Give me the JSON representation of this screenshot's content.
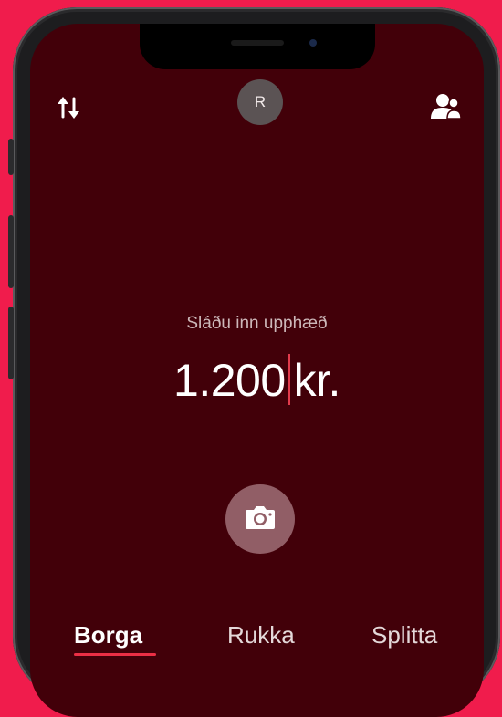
{
  "header": {
    "avatar_initial": "R",
    "icons": [
      "swap-arrows-icon",
      "avatar",
      "contacts-icon"
    ]
  },
  "main": {
    "prompt": "Sláðu inn upphæð",
    "amount_value": "1.200",
    "amount_unit": "kr.",
    "camera_icon": "camera-icon"
  },
  "tabs": [
    {
      "label": "Borga",
      "active": true
    },
    {
      "label": "Rukka",
      "active": false
    },
    {
      "label": "Splitta",
      "active": false
    }
  ],
  "colors": {
    "background": "#f01c4c",
    "screen": "#420009",
    "accent": "#ec2f45"
  }
}
